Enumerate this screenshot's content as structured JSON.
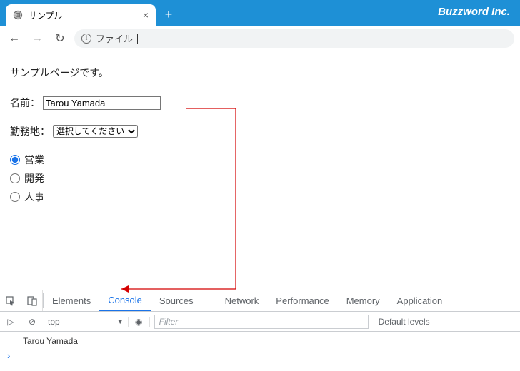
{
  "chrome": {
    "tab_title": "サンプル",
    "newtab": "+",
    "brand": "Buzzword Inc.",
    "url_label": "ファイル",
    "back_glyph": "←",
    "forward_glyph": "→",
    "reload_glyph": "↻",
    "close_glyph": "×",
    "info_glyph": "i"
  },
  "page": {
    "intro": "サンプルページです。",
    "name_label": "名前：",
    "name_value": "Tarou Yamada",
    "loc_label": "勤務地：",
    "loc_selected": "選択してください",
    "radios": [
      {
        "label": "営業",
        "checked": true
      },
      {
        "label": "開発",
        "checked": false
      },
      {
        "label": "人事",
        "checked": false
      }
    ]
  },
  "devtools": {
    "tabs": [
      "Elements",
      "Console",
      "Sources",
      "Network",
      "Performance",
      "Memory",
      "Application"
    ],
    "active_tab": "Console",
    "context": "top",
    "filter_placeholder": "Filter",
    "levels": "Default levels",
    "log_line": "Tarou Yamada",
    "prompt": "›",
    "play_glyph": "▷",
    "clear_glyph": "⊘",
    "tri_glyph": "▼",
    "eye_glyph": "◉"
  }
}
